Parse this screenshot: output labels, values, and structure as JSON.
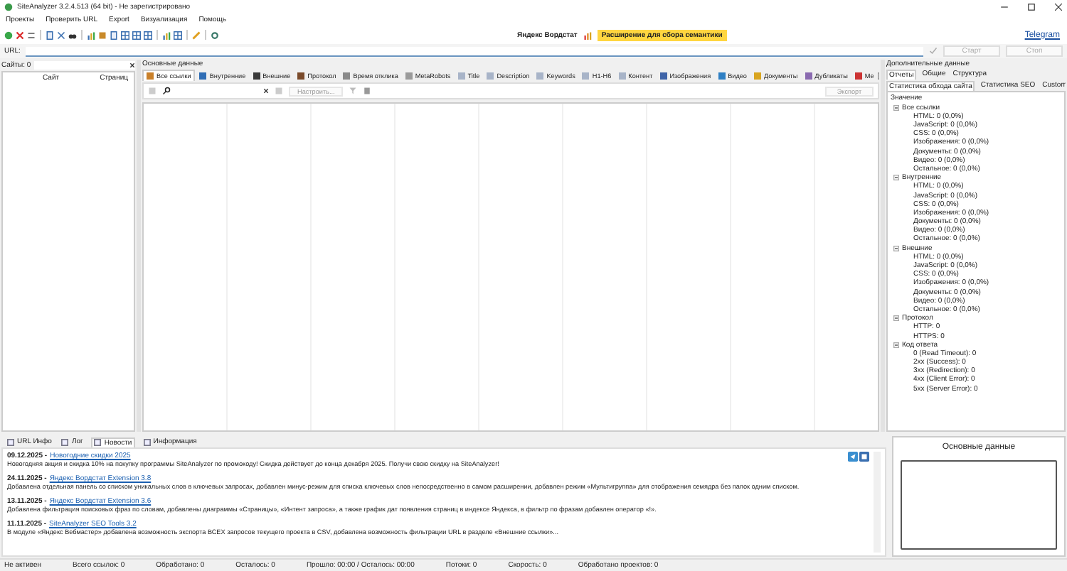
{
  "window": {
    "title": "SiteAnalyzer 3.2.4.513 (64 bit) - Не зарегистрировано"
  },
  "menu": [
    "Проекты",
    "Проверить URL",
    "Export",
    "Визуализация",
    "Помощь"
  ],
  "promo": {
    "label": "Яндекс Вордстат",
    "highlight": "Расширение для сбора семантики"
  },
  "telegram_link": "Telegram",
  "url_bar": {
    "label": "URL:",
    "buttons": [
      {
        "label": "Старт",
        "disabled": true
      },
      {
        "label": "Стоп",
        "disabled": true
      }
    ]
  },
  "sites_panel": {
    "label": "Сайты: 0",
    "columns": [
      "Сайт",
      "Страниц"
    ]
  },
  "main_panel": {
    "title": "Основные данные",
    "tabs": [
      {
        "label": "Все ссылки",
        "selected": true
      },
      {
        "label": "Внутренние",
        "selected": false
      },
      {
        "label": "Внешние",
        "selected": false
      },
      {
        "label": "Протокол",
        "selected": false
      },
      {
        "label": "Время отклика",
        "selected": false
      },
      {
        "label": "MetaRobots",
        "selected": false
      },
      {
        "label": "Title",
        "selected": false
      },
      {
        "label": "Description",
        "selected": false
      },
      {
        "label": "Keywords",
        "selected": false
      },
      {
        "label": "H1-H6",
        "selected": false
      },
      {
        "label": "Контент",
        "selected": false
      },
      {
        "label": "Изображения",
        "selected": false
      },
      {
        "label": "Видео",
        "selected": false
      },
      {
        "label": "Документы",
        "selected": false
      },
      {
        "label": "Дубликаты",
        "selected": false
      },
      {
        "label": "Ме",
        "selected": false
      }
    ],
    "filter_button": "Настроить...",
    "export_button": "Экспорт"
  },
  "extra_panel": {
    "title": "Дополнительные данные",
    "tabs": [
      {
        "label": "Отчеты",
        "selected": true
      },
      {
        "label": "Общие",
        "selected": false
      },
      {
        "label": "Структура",
        "selected": false
      }
    ],
    "subtabs": [
      {
        "label": "Статистика обхода сайта",
        "selected": true
      },
      {
        "label": "Статистика SEO",
        "selected": false
      },
      {
        "label": "Custom",
        "selected": false
      }
    ],
    "tree": {
      "label": "Значение",
      "children": [
        {
          "label": "Все ссылки",
          "expanded": true,
          "children": [
            {
              "label": "HTML: 0 (0,0%)"
            },
            {
              "label": "JavaScript: 0 (0,0%)"
            },
            {
              "label": "CSS: 0 (0,0%)"
            },
            {
              "label": "Изображения: 0 (0,0%)"
            },
            {
              "label": "Документы: 0 (0,0%)"
            },
            {
              "label": "Видео: 0 (0,0%)"
            },
            {
              "label": "Остальное: 0 (0,0%)"
            }
          ]
        },
        {
          "label": "Внутренние",
          "expanded": true,
          "children": [
            {
              "label": "HTML: 0 (0,0%)"
            },
            {
              "label": "JavaScript: 0 (0,0%)"
            },
            {
              "label": "CSS: 0 (0,0%)"
            },
            {
              "label": "Изображения: 0 (0,0%)"
            },
            {
              "label": "Документы: 0 (0,0%)"
            },
            {
              "label": "Видео: 0 (0,0%)"
            },
            {
              "label": "Остальное: 0 (0,0%)"
            }
          ]
        },
        {
          "label": "Внешние",
          "expanded": true,
          "children": [
            {
              "label": "HTML: 0 (0,0%)"
            },
            {
              "label": "JavaScript: 0 (0,0%)"
            },
            {
              "label": "CSS: 0 (0,0%)"
            },
            {
              "label": "Изображения: 0 (0,0%)"
            },
            {
              "label": "Документы: 0 (0,0%)"
            },
            {
              "label": "Видео: 0 (0,0%)"
            },
            {
              "label": "Остальное: 0 (0,0%)"
            }
          ]
        },
        {
          "label": "Протокол",
          "expanded": true,
          "children": [
            {
              "label": "HTTP: 0"
            },
            {
              "label": "HTTPS: 0"
            }
          ]
        },
        {
          "label": "Код ответа",
          "expanded": true,
          "children": [
            {
              "label": "0 (Read Timeout): 0"
            },
            {
              "label": "2xx (Success): 0"
            },
            {
              "label": "3xx (Redirection): 0"
            },
            {
              "label": "4xx (Client Error): 0"
            },
            {
              "label": "5xx (Server Error): 0"
            }
          ]
        }
      ]
    }
  },
  "bottom_tabs": [
    {
      "label": "URL Инфо",
      "selected": false
    },
    {
      "label": "Лог",
      "selected": false
    },
    {
      "label": "Новости",
      "selected": true
    },
    {
      "label": "Информация",
      "selected": false
    }
  ],
  "news": [
    {
      "date": "09.12.2025 -",
      "link": "Новогодние скидки 2025",
      "text": "Новогодняя акция и скидка 10% на покупку программы SiteAnalyzer по промокоду! Скидка действует до конца декабря 2025. Получи свою скидку на SiteAnalyzer!"
    },
    {
      "date": "24.11.2025 -",
      "link": "Яндекс Вордстат Extension 3.8",
      "text": "Добавлена отдельная панель со списком уникальных слов в ключевых запросах, добавлен минус-режим для списка ключевых слов непосредственно в самом расширении, добавлен режим «Мультигруппа» для отображения семядра без папок одним списком."
    },
    {
      "date": "13.11.2025 -",
      "link": "Яндекс Вордстат Extension 3.6",
      "text": "Добавлена фильтрация поисковых фраз по словам, добавлены диаграммы «Страницы», «Интент запроса», а также график дат появления страниц в индексе Яндекса, в фильтр по фразам добавлен оператор «!»."
    },
    {
      "date": "11.11.2025 -",
      "link": "SiteAnalyzer SEO Tools 3.2",
      "text": "В модуле «Яндекс Вебмастер» добавлена возможность экспорта ВСЕХ запросов текущего проекта в CSV, добавлена возможность фильтрации URL в разделе «Внешние ссылки»..."
    }
  ],
  "preview": {
    "title": "Основные данные"
  },
  "status_bar": [
    "Не активен",
    "Всего ссылок: 0",
    "Обработано: 0",
    "Осталось: 0",
    "Прошло: 00:00 / Осталось: 00:00",
    "Потоки: 0",
    "Скорость: 0",
    "Обработано проектов: 0"
  ]
}
